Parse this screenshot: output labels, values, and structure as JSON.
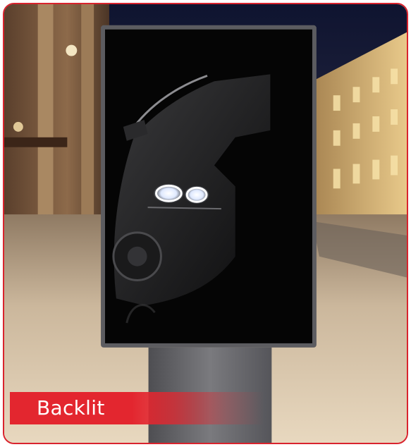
{
  "card": {
    "border_color": "#d9232d",
    "label": "Backlit",
    "label_color": "#e3262f"
  },
  "scene": {
    "billboard_icon": "backlit-billboard-photo",
    "poster_icon": "black-sports-car-headlights"
  }
}
